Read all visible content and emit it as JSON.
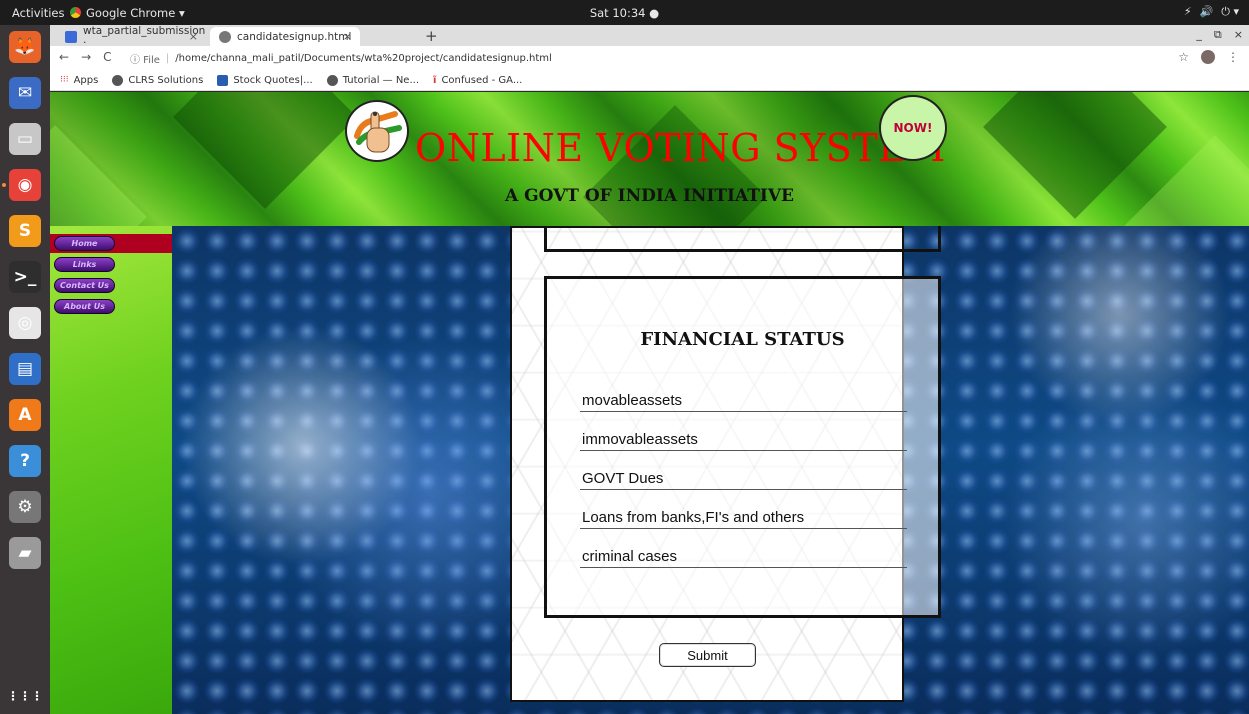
{
  "os": {
    "activities": "Activities",
    "app_name": "Google Chrome ▾",
    "clock": "Sat 10:34 ●",
    "tray": [
      "⚡",
      "🔊",
      "⏻ ▾"
    ]
  },
  "dock": {
    "items": [
      {
        "name": "firefox-icon",
        "color": "#e8632a",
        "glyph": "🦊"
      },
      {
        "name": "thunderbird-icon",
        "color": "#3b6bc4",
        "glyph": "✉"
      },
      {
        "name": "files-icon",
        "color": "#c7c7c7",
        "glyph": "▭"
      },
      {
        "name": "chrome-icon",
        "color": "#e6423a",
        "glyph": "◉"
      },
      {
        "name": "sublime-icon",
        "color": "#f29a1a",
        "glyph": "S"
      },
      {
        "name": "terminal-icon",
        "color": "#2e2e2e",
        "glyph": ">_"
      },
      {
        "name": "rhythmbox-icon",
        "color": "#e6e6e6",
        "glyph": "◎"
      },
      {
        "name": "writer-icon",
        "color": "#2f6fc7",
        "glyph": "▤"
      },
      {
        "name": "software-icon",
        "color": "#f07a1a",
        "glyph": "A"
      },
      {
        "name": "help-icon",
        "color": "#3a8fd8",
        "glyph": "?"
      },
      {
        "name": "settings-icon",
        "color": "#777777",
        "glyph": "⚙"
      },
      {
        "name": "disk-icon",
        "color": "#9a9a9a",
        "glyph": "▰"
      }
    ],
    "show_apps": "⋮⋮⋮"
  },
  "browser": {
    "tabs": [
      {
        "title": "wta_partial_submission ·",
        "favicon_color": "#3b6bd6",
        "active": false
      },
      {
        "title": "candidatesignup.html",
        "favicon_color": "#777777",
        "active": true
      }
    ],
    "new_tab": "+",
    "window_controls": [
      "_",
      "⧉",
      "×"
    ],
    "tab_close": "×",
    "address": {
      "scheme": "ⓘ File",
      "separator": "|",
      "url": "/home/channa_mali_patil/Documents/wta%20project/candidatesignup.html"
    },
    "nav": [
      "←",
      "→",
      "C"
    ],
    "star": "☆",
    "menu": "⋮",
    "bookmarks": [
      {
        "label": "Apps",
        "color": "#c33"
      },
      {
        "label": "CLRS Solutions",
        "color": "#555"
      },
      {
        "label": "Stock Quotes|...",
        "color": "#2a5db0"
      },
      {
        "label": "Tutorial — Ne...",
        "color": "#555"
      },
      {
        "label": "Confused - GA...",
        "color": "#d33"
      }
    ]
  },
  "site": {
    "title": "ONLINE VOTING SYSTEM",
    "subtitle": "A GOVT OF INDIA INITIATIVE",
    "badge": "NOW!",
    "nav": [
      "Home",
      "Links",
      "Contact Us",
      "About Us"
    ]
  },
  "form": {
    "section_title": "FINANCIAL STATUS",
    "fields": [
      {
        "placeholder": "movableassets"
      },
      {
        "placeholder": "immovableassets"
      },
      {
        "placeholder": "GOVT Dues"
      },
      {
        "placeholder": "Loans from banks,FI's and others"
      },
      {
        "placeholder": "criminal cases"
      }
    ],
    "submit": "Submit"
  },
  "colors": {
    "title_red": "#ff0000",
    "nav_purple": "#5a1f94",
    "nav_active": "#b00020"
  }
}
